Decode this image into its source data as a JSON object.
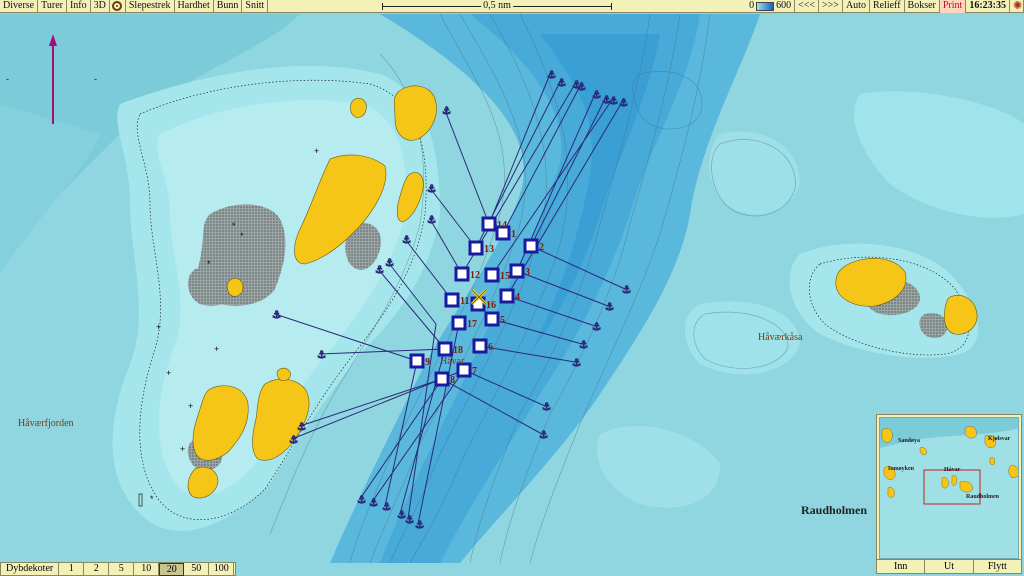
{
  "toolbar": {
    "left_items": [
      "Diverse",
      "Turer",
      "Info",
      "3D"
    ],
    "middle_items": [
      "Slepestrek",
      "Hardhet",
      "Bunn",
      "Snitt"
    ],
    "scale_label": "0,5 nm",
    "depth_min": "0",
    "depth_max": "600",
    "nav_back": "<<<",
    "nav_fwd": ">>>",
    "auto": "Auto",
    "relief": "Relieff",
    "boxes": "Bokser",
    "print": "Print",
    "time": "16:23:35",
    "gear_icon": "gear-icon",
    "compass_icon": "compass-icon"
  },
  "map": {
    "places": {
      "havaerfjorden": "Håværfjorden",
      "havaerkasa": "Håværkåsa",
      "havar": "Håvar",
      "raudholmen": "Raudholmen"
    },
    "stations": [
      "1",
      "2",
      "3",
      "4",
      "5",
      "6",
      "7",
      "8",
      "9",
      "11",
      "12",
      "13",
      "14",
      "15",
      "16",
      "17",
      "18"
    ],
    "colors": {
      "land": "#f5c518",
      "shallow": "#9fe3ea",
      "deep": "#3aa5d8",
      "track": "#2a2a7a",
      "station": "#1a1aa0"
    }
  },
  "bottombar": {
    "label": "Dybdekoter",
    "values": [
      "1",
      "2",
      "5",
      "10",
      "20",
      "50",
      "100"
    ],
    "active": "20"
  },
  "minimap": {
    "labels": {
      "sandoya": "Sandøya",
      "kjolsvar": "Kjølsvar",
      "inmoyken": "Inmøyken",
      "havar": "Håvar",
      "raudholmen": "Raudholmen"
    },
    "buttons": [
      "Inn",
      "Ut",
      "Flytt"
    ]
  }
}
